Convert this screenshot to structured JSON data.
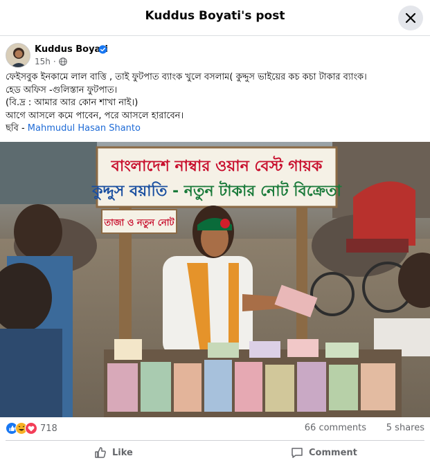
{
  "header": {
    "title": "Kuddus Boyati's post",
    "close_icon": "close-icon"
  },
  "post": {
    "author_name": "Kuddus Boyati",
    "time": "15h",
    "privacy_icon": "globe-icon",
    "text_lines": [
      "ফেইসবুক ইনকামে লাল বাত্তি , তাই ফুটপাত ব্যাংক খুলে বসলাম( কুদ্দুস ভাইয়ের কচ কচা টাকার ব্যাংক।",
      "হেড অফিস -গুলিস্তান ফুটপাত।",
      "(বি.দ্র : আমার আর কোন শাখা নাই।)",
      "আগে আসলে কমে পাবেন, পরে আসলে হারাবেন।"
    ],
    "credit_prefix": "ছবি - ",
    "credit_name": "Mahmudul Hasan Shanto"
  },
  "photo": {
    "sign_line1": "বাংলাদেশ নাম্বার ওয়ান বেস্ট গায়ক",
    "sign_line2_name": "কুদ্দুস বয়াতি",
    "sign_line2_rest": " - নতুন টাকার নোট বিক্রেতা",
    "small_sign": "তাজা ও নতুন নোট"
  },
  "stats": {
    "reactions_count": "718",
    "comments": "66 comments",
    "shares": "5 shares"
  },
  "actions": {
    "like": "Like",
    "comment": "Comment"
  },
  "colors": {
    "link": "#1d6ad6",
    "like_blue": "#1877f2",
    "love_red": "#f33e58",
    "haha_yellow": "#f7b125",
    "sign_red": "#c8102e",
    "sign_green": "#1a7a3a"
  }
}
